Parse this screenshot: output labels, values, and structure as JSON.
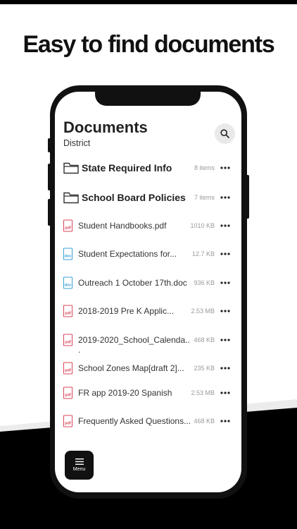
{
  "headline": "Easy to find documents",
  "screen": {
    "title": "Documents",
    "subtitle": "District",
    "search_icon": "search-icon"
  },
  "folders": [
    {
      "name": "State Required Info",
      "meta": "8 items"
    },
    {
      "name": "School Board Policies",
      "meta": "7 items"
    }
  ],
  "files": [
    {
      "type": "pdf",
      "name": "Student Handbooks.pdf",
      "size": "1010 KB"
    },
    {
      "type": "doc",
      "name": "Student Expectations for...",
      "size": "12.7 KB"
    },
    {
      "type": "doc",
      "name": "Outreach 1 October 17th.doc",
      "size": "936 KB"
    },
    {
      "type": "pdf",
      "name": "2018-2019 Pre K Applic...",
      "size": "2.53 MB"
    },
    {
      "type": "pdf",
      "name": "2019-2020_School_Calenda..",
      "name2": ".",
      "size": "468 KB"
    },
    {
      "type": "pdf",
      "name": "School Zones Map[draft 2]...",
      "size": "235 KB"
    },
    {
      "type": "pdf",
      "name": "FR app 2019-20 Spanish",
      "size": "2.53 MB"
    },
    {
      "type": "pdf",
      "name": "Frequently Asked Questions...",
      "size": "468 KB"
    }
  ],
  "file_icon_labels": {
    "pdf": "pdf",
    "doc": "doc"
  },
  "menu": {
    "label": "Menu"
  },
  "colors": {
    "pdf": "#d9475a",
    "doc": "#3aa0d8",
    "dark": "#111111"
  }
}
